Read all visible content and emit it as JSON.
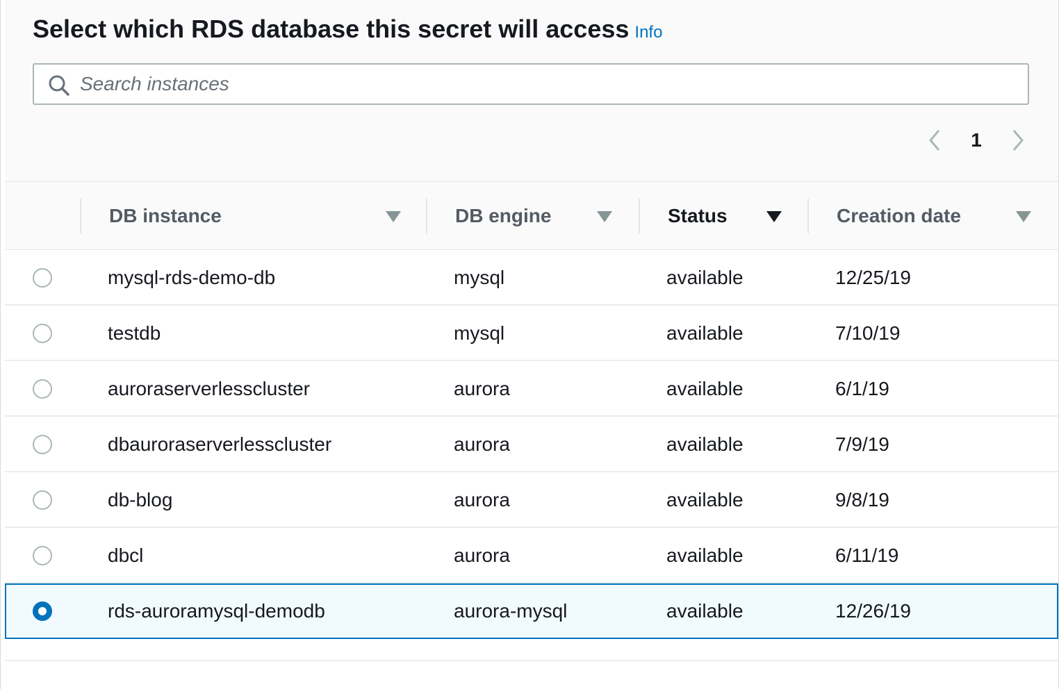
{
  "header": {
    "title": "Select which RDS database this secret will access",
    "info_label": "Info"
  },
  "search": {
    "placeholder": "Search instances",
    "value": ""
  },
  "pagination": {
    "current_page": "1"
  },
  "table": {
    "columns": [
      {
        "label": "DB instance",
        "sorted": false
      },
      {
        "label": "DB engine",
        "sorted": false
      },
      {
        "label": "Status",
        "sorted": true
      },
      {
        "label": "Creation date",
        "sorted": false
      }
    ],
    "rows": [
      {
        "instance": "mysql-rds-demo-db",
        "engine": "mysql",
        "status": "available",
        "created": "12/25/19",
        "selected": false
      },
      {
        "instance": "testdb",
        "engine": "mysql",
        "status": "available",
        "created": "7/10/19",
        "selected": false
      },
      {
        "instance": "auroraserverlesscluster",
        "engine": "aurora",
        "status": "available",
        "created": "6/1/19",
        "selected": false
      },
      {
        "instance": "dbauroraserverlesscluster",
        "engine": "aurora",
        "status": "available",
        "created": "7/9/19",
        "selected": false
      },
      {
        "instance": "db-blog",
        "engine": "aurora",
        "status": "available",
        "created": "9/8/19",
        "selected": false
      },
      {
        "instance": "dbcl",
        "engine": "aurora",
        "status": "available",
        "created": "6/11/19",
        "selected": false
      },
      {
        "instance": "rds-auroramysql-demodb",
        "engine": "aurora-mysql",
        "status": "available",
        "created": "12/26/19",
        "selected": true
      }
    ]
  },
  "colors": {
    "accent": "#0073bb",
    "selected_row_bg": "#f1faff",
    "border": "#aab7b8"
  }
}
